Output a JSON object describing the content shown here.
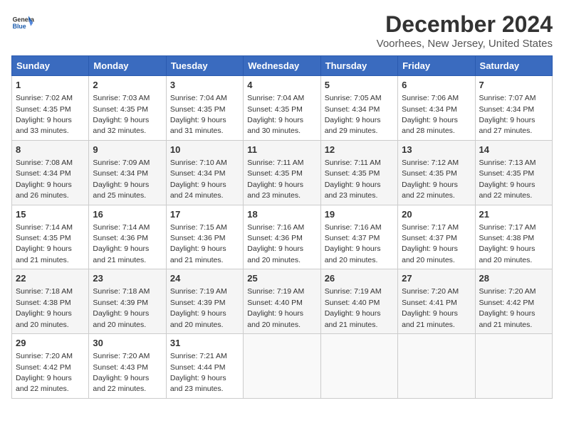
{
  "header": {
    "logo_line1": "General",
    "logo_line2": "Blue",
    "month": "December 2024",
    "location": "Voorhees, New Jersey, United States"
  },
  "weekdays": [
    "Sunday",
    "Monday",
    "Tuesday",
    "Wednesday",
    "Thursday",
    "Friday",
    "Saturday"
  ],
  "weeks": [
    [
      {
        "day": 1,
        "sunrise": "7:02 AM",
        "sunset": "4:35 PM",
        "daylight": "9 hours and 33 minutes."
      },
      {
        "day": 2,
        "sunrise": "7:03 AM",
        "sunset": "4:35 PM",
        "daylight": "9 hours and 32 minutes."
      },
      {
        "day": 3,
        "sunrise": "7:04 AM",
        "sunset": "4:35 PM",
        "daylight": "9 hours and 31 minutes."
      },
      {
        "day": 4,
        "sunrise": "7:04 AM",
        "sunset": "4:35 PM",
        "daylight": "9 hours and 30 minutes."
      },
      {
        "day": 5,
        "sunrise": "7:05 AM",
        "sunset": "4:34 PM",
        "daylight": "9 hours and 29 minutes."
      },
      {
        "day": 6,
        "sunrise": "7:06 AM",
        "sunset": "4:34 PM",
        "daylight": "9 hours and 28 minutes."
      },
      {
        "day": 7,
        "sunrise": "7:07 AM",
        "sunset": "4:34 PM",
        "daylight": "9 hours and 27 minutes."
      }
    ],
    [
      {
        "day": 8,
        "sunrise": "7:08 AM",
        "sunset": "4:34 PM",
        "daylight": "9 hours and 26 minutes."
      },
      {
        "day": 9,
        "sunrise": "7:09 AM",
        "sunset": "4:34 PM",
        "daylight": "9 hours and 25 minutes."
      },
      {
        "day": 10,
        "sunrise": "7:10 AM",
        "sunset": "4:34 PM",
        "daylight": "9 hours and 24 minutes."
      },
      {
        "day": 11,
        "sunrise": "7:11 AM",
        "sunset": "4:35 PM",
        "daylight": "9 hours and 23 minutes."
      },
      {
        "day": 12,
        "sunrise": "7:11 AM",
        "sunset": "4:35 PM",
        "daylight": "9 hours and 23 minutes."
      },
      {
        "day": 13,
        "sunrise": "7:12 AM",
        "sunset": "4:35 PM",
        "daylight": "9 hours and 22 minutes."
      },
      {
        "day": 14,
        "sunrise": "7:13 AM",
        "sunset": "4:35 PM",
        "daylight": "9 hours and 22 minutes."
      }
    ],
    [
      {
        "day": 15,
        "sunrise": "7:14 AM",
        "sunset": "4:35 PM",
        "daylight": "9 hours and 21 minutes."
      },
      {
        "day": 16,
        "sunrise": "7:14 AM",
        "sunset": "4:36 PM",
        "daylight": "9 hours and 21 minutes."
      },
      {
        "day": 17,
        "sunrise": "7:15 AM",
        "sunset": "4:36 PM",
        "daylight": "9 hours and 21 minutes."
      },
      {
        "day": 18,
        "sunrise": "7:16 AM",
        "sunset": "4:36 PM",
        "daylight": "9 hours and 20 minutes."
      },
      {
        "day": 19,
        "sunrise": "7:16 AM",
        "sunset": "4:37 PM",
        "daylight": "9 hours and 20 minutes."
      },
      {
        "day": 20,
        "sunrise": "7:17 AM",
        "sunset": "4:37 PM",
        "daylight": "9 hours and 20 minutes."
      },
      {
        "day": 21,
        "sunrise": "7:17 AM",
        "sunset": "4:38 PM",
        "daylight": "9 hours and 20 minutes."
      }
    ],
    [
      {
        "day": 22,
        "sunrise": "7:18 AM",
        "sunset": "4:38 PM",
        "daylight": "9 hours and 20 minutes."
      },
      {
        "day": 23,
        "sunrise": "7:18 AM",
        "sunset": "4:39 PM",
        "daylight": "9 hours and 20 minutes."
      },
      {
        "day": 24,
        "sunrise": "7:19 AM",
        "sunset": "4:39 PM",
        "daylight": "9 hours and 20 minutes."
      },
      {
        "day": 25,
        "sunrise": "7:19 AM",
        "sunset": "4:40 PM",
        "daylight": "9 hours and 20 minutes."
      },
      {
        "day": 26,
        "sunrise": "7:19 AM",
        "sunset": "4:40 PM",
        "daylight": "9 hours and 21 minutes."
      },
      {
        "day": 27,
        "sunrise": "7:20 AM",
        "sunset": "4:41 PM",
        "daylight": "9 hours and 21 minutes."
      },
      {
        "day": 28,
        "sunrise": "7:20 AM",
        "sunset": "4:42 PM",
        "daylight": "9 hours and 21 minutes."
      }
    ],
    [
      {
        "day": 29,
        "sunrise": "7:20 AM",
        "sunset": "4:42 PM",
        "daylight": "9 hours and 22 minutes."
      },
      {
        "day": 30,
        "sunrise": "7:20 AM",
        "sunset": "4:43 PM",
        "daylight": "9 hours and 22 minutes."
      },
      {
        "day": 31,
        "sunrise": "7:21 AM",
        "sunset": "4:44 PM",
        "daylight": "9 hours and 23 minutes."
      },
      null,
      null,
      null,
      null
    ]
  ],
  "labels": {
    "sunrise": "Sunrise:",
    "sunset": "Sunset:",
    "daylight": "Daylight hours"
  }
}
